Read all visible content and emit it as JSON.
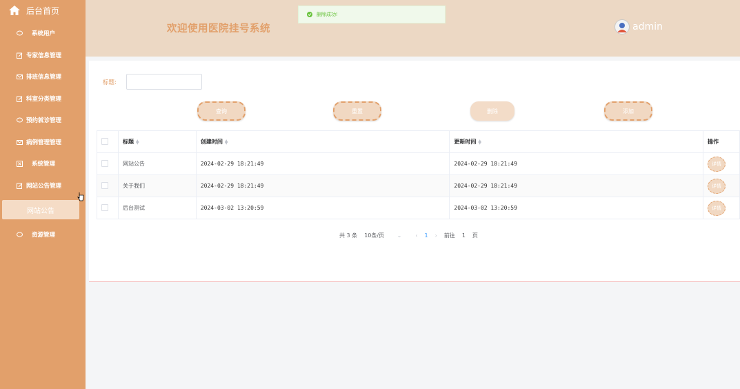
{
  "sidebar": {
    "home_label": "后台首页",
    "items": [
      {
        "label": "系统用户",
        "icon": "chat-icon"
      },
      {
        "label": "专家信息管理",
        "icon": "edit-icon"
      },
      {
        "label": "排班信息管理",
        "icon": "mail-icon"
      },
      {
        "label": "科室分类管理",
        "icon": "edit-icon"
      },
      {
        "label": "预约就诊管理",
        "icon": "chat-icon"
      },
      {
        "label": "病例管理管理",
        "icon": "mail-icon"
      },
      {
        "label": "系统管理",
        "icon": "close-box-icon"
      },
      {
        "label": "网站公告管理",
        "icon": "edit-icon"
      },
      {
        "label": "资源管理",
        "icon": "chat-icon"
      }
    ],
    "active_sub": "网站公告"
  },
  "header": {
    "title": "欢迎使用医院挂号系统",
    "username": "admin"
  },
  "toast": {
    "message": "删除成功!"
  },
  "search": {
    "label": "标题:",
    "value": "",
    "placeholder": ""
  },
  "buttons": {
    "query": "查询",
    "reset": "重置",
    "delete": "删除",
    "add": "添加"
  },
  "table": {
    "headers": {
      "title": "标题",
      "created": "创建时间",
      "updated": "更新时间",
      "action": "操作"
    },
    "rows": [
      {
        "title": "网站公告",
        "created": "2024-02-29 18:21:49",
        "updated": "2024-02-29 18:21:49",
        "action": "详情"
      },
      {
        "title": "关于我们",
        "created": "2024-02-29 18:21:49",
        "updated": "2024-02-29 18:21:49",
        "action": "详情"
      },
      {
        "title": "后台测试",
        "created": "2024-03-02 13:20:59",
        "updated": "2024-03-02 13:20:59",
        "action": "详情"
      }
    ]
  },
  "pagination": {
    "total": "共 3 条",
    "page_size": "10条/页",
    "current": "1",
    "goto_prefix": "前往",
    "goto_value": "1",
    "goto_suffix": "页"
  },
  "colors": {
    "accent": "#e2a06b",
    "header_bg": "#ecd8c4",
    "success": "#67c23a"
  }
}
